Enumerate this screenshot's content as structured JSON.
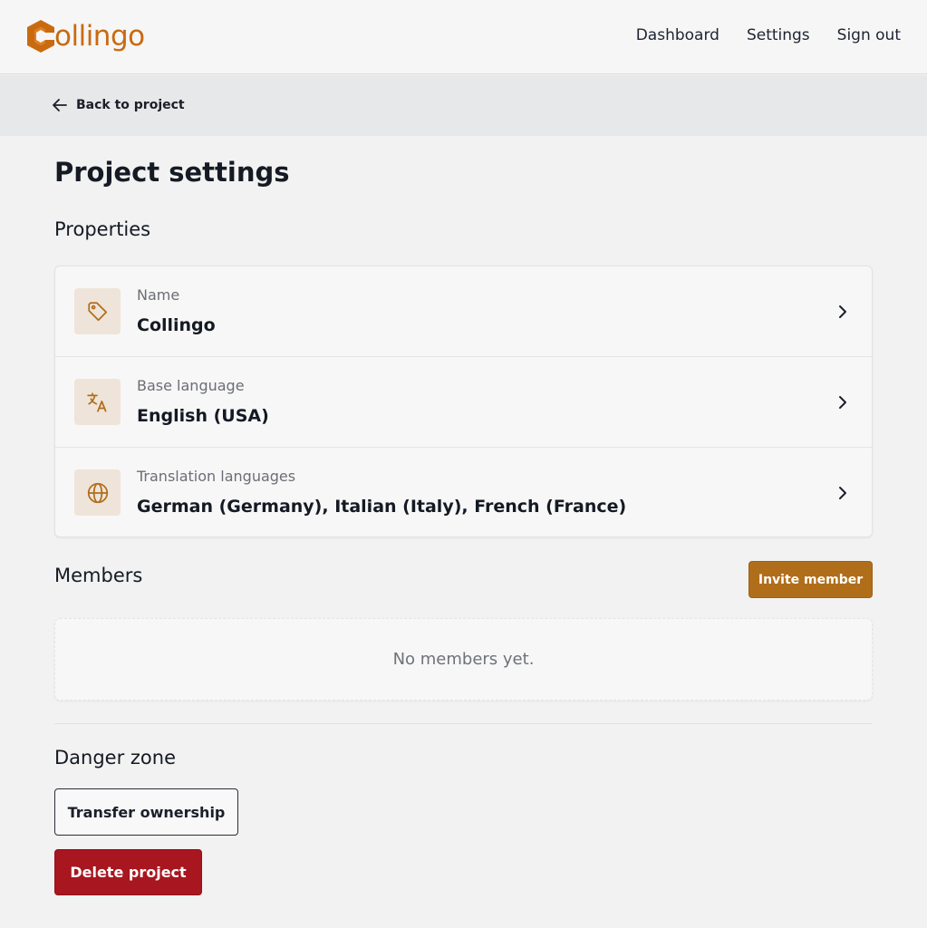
{
  "brand": {
    "name": "ollingo",
    "accent": "#c96a10",
    "logo_icon": "collingo-logo-icon"
  },
  "nav": {
    "items": [
      {
        "label": "Dashboard"
      },
      {
        "label": "Settings"
      },
      {
        "label": "Sign out"
      }
    ]
  },
  "back": {
    "label": "Back to project",
    "icon": "arrow-left-icon"
  },
  "page": {
    "title": "Project settings"
  },
  "properties": {
    "title": "Properties",
    "rows": [
      {
        "label": "Name",
        "value": "Collingo",
        "icon": "tag-icon"
      },
      {
        "label": "Base language",
        "value": "English (USA)",
        "icon": "translate-icon"
      },
      {
        "label": "Translation languages",
        "value": "German (Germany), Italian (Italy), French (France)",
        "icon": "globe-icon"
      }
    ]
  },
  "members": {
    "title": "Members",
    "invite_label": "Invite member",
    "empty_text": "No members yet."
  },
  "danger": {
    "title": "Danger zone",
    "transfer_label": "Transfer ownership",
    "delete_label": "Delete project",
    "delete_color": "#a8161f"
  }
}
